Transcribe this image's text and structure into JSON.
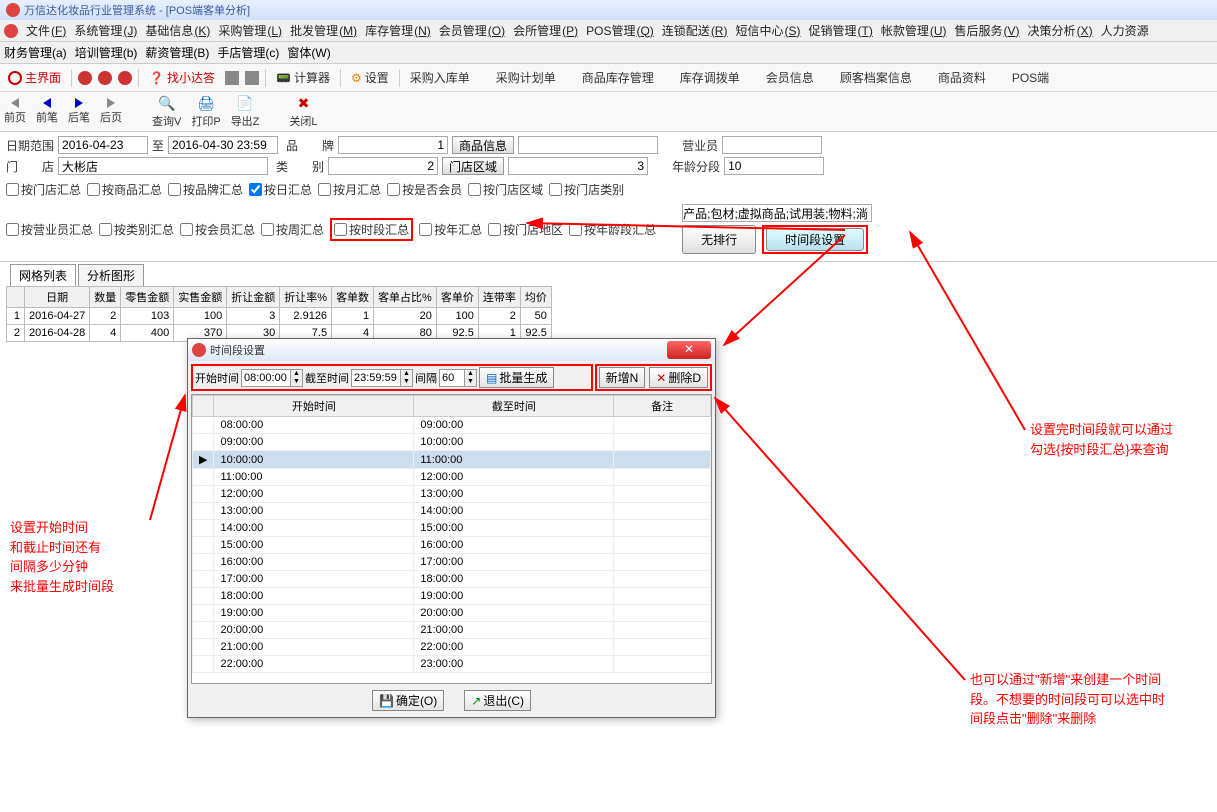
{
  "window": {
    "title": "万信达化妆品行业管理系统 - [POS端客单分析]"
  },
  "menu": [
    {
      "t": "文件",
      "u": "(F)"
    },
    {
      "t": "系统管理",
      "u": "(J)"
    },
    {
      "t": "基础信息",
      "u": "(K)"
    },
    {
      "t": "采购管理",
      "u": "(L)"
    },
    {
      "t": "批发管理",
      "u": "(M)"
    },
    {
      "t": "库存管理",
      "u": "(N)"
    },
    {
      "t": "会员管理",
      "u": "(O)"
    },
    {
      "t": "会所管理",
      "u": "(P)"
    },
    {
      "t": "POS管理",
      "u": "(Q)"
    },
    {
      "t": "连锁配送",
      "u": "(R)"
    },
    {
      "t": "短信中心",
      "u": "(S)"
    },
    {
      "t": "促销管理",
      "u": "(T)"
    },
    {
      "t": "帐款管理",
      "u": "(U)"
    },
    {
      "t": "售后服务",
      "u": "(V)"
    },
    {
      "t": "决策分析",
      "u": "(X)"
    },
    {
      "t": "人力资源",
      "u": ""
    }
  ],
  "menu2": [
    {
      "t": "财务管理",
      "u": "(a)"
    },
    {
      "t": "培训管理",
      "u": "(b)"
    },
    {
      "t": "薪资管理",
      "u": "(B)"
    },
    {
      "t": "手店管理",
      "u": "(c)"
    },
    {
      "t": "窗体",
      "u": "(W)"
    }
  ],
  "tb1": {
    "main": "主界面",
    "find": "找小达答",
    "calc": "计算器",
    "settings": "设置",
    "items": [
      "采购入库单",
      "采购计划单",
      "商品库存管理",
      "库存调拨单",
      "会员信息",
      "顾客档案信息",
      "商品资料",
      "POS端"
    ]
  },
  "tb2": {
    "first": "前页",
    "prev": "前笔",
    "next": "后笔",
    "last": "后页",
    "query": "查询V",
    "print": "打印P",
    "export": "导出Z",
    "close": "关闭L"
  },
  "filters": {
    "dateLabel": "日期范围",
    "dateFrom": "2016-04-23",
    "to": "至",
    "dateTo": "2016-04-30 23:59",
    "brandLbl": "品　　牌",
    "brandVal": "1",
    "goodsBtn": "商品信息",
    "salesLbl": "营业员",
    "storeLbl": "门　　店",
    "storeVal": "大彬店",
    "catLbl": "类　　别",
    "catVal": "2",
    "areaBtn": "门店区域",
    "areaVal": "3",
    "ageLbl": "年龄分段",
    "ageVal": "10"
  },
  "checks": [
    "按门店汇总",
    "按商品汇总",
    "按品牌汇总",
    "按日汇总",
    "按月汇总",
    "按是否会员",
    "按门店区域",
    "按门店类别",
    "按营业员汇总",
    "按类别汇总",
    "按会员汇总",
    "按周汇总",
    "按时段汇总",
    "按年汇总",
    "按门店地区",
    "按年龄段汇总"
  ],
  "panel": {
    "prodLbl": "产品;包材;虚拟商品;试用装;物料;淌",
    "noSort": "无排行",
    "timeSet": "时间段设置"
  },
  "gridTabs": {
    "t1": "网格列表",
    "t2": "分析图形"
  },
  "grid": {
    "headers": [
      "日期",
      "数量",
      "零售金额",
      "实售金额",
      "折让金额",
      "折让率%",
      "客单数",
      "客单占比%",
      "客单价",
      "连带率",
      "均价"
    ],
    "rows": [
      [
        "1",
        "2016-04-27",
        "2",
        "103",
        "100",
        "3",
        "2.9126",
        "1",
        "20",
        "100",
        "2",
        "50"
      ],
      [
        "2",
        "2016-04-28",
        "4",
        "400",
        "370",
        "30",
        "7.5",
        "4",
        "80",
        "92.5",
        "1",
        "92.5"
      ]
    ]
  },
  "dialog": {
    "title": "时间段设置",
    "startLbl": "开始时间",
    "startVal": "08:00:00",
    "endLbl": "截至时间",
    "endVal": "23:59:59",
    "intLbl": "间隔",
    "intVal": "60",
    "batch": "批量生成",
    "add": "新增N",
    "del": "删除D",
    "th": [
      "开始时间",
      "截至时间",
      "备注"
    ],
    "rows": [
      [
        "08:00:00",
        "09:00:00"
      ],
      [
        "09:00:00",
        "10:00:00"
      ],
      [
        "10:00:00",
        "11:00:00"
      ],
      [
        "11:00:00",
        "12:00:00"
      ],
      [
        "12:00:00",
        "13:00:00"
      ],
      [
        "13:00:00",
        "14:00:00"
      ],
      [
        "14:00:00",
        "15:00:00"
      ],
      [
        "15:00:00",
        "16:00:00"
      ],
      [
        "16:00:00",
        "17:00:00"
      ],
      [
        "17:00:00",
        "18:00:00"
      ],
      [
        "18:00:00",
        "19:00:00"
      ],
      [
        "19:00:00",
        "20:00:00"
      ],
      [
        "20:00:00",
        "21:00:00"
      ],
      [
        "21:00:00",
        "22:00:00"
      ],
      [
        "22:00:00",
        "23:00:00"
      ]
    ],
    "ok": "确定(O)",
    "exit": "退出(C)"
  },
  "anno": {
    "left": "设置开始时间\n和截止时间还有\n间隔多少分钟\n来批量生成时间段",
    "right1": "设置完时间段就可以通过\n勾选{按时段汇总}来查询",
    "right2": "也可以通过\"新增\"来创建一个时间\n段。不想要的时间段可可以选中时\n间段点击\"删除\"来删除"
  }
}
